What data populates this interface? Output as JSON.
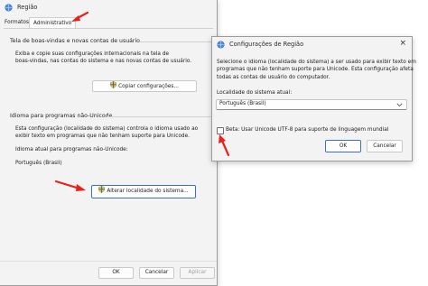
{
  "main_window": {
    "title": "Região",
    "tabs": [
      {
        "label": "Formatos"
      },
      {
        "label": "Administrativo"
      }
    ],
    "welcome_section": {
      "title": "Tela de boas-vindas e novas contas de usuário",
      "lines": [
        "Exiba e copie suas configurações internacionais na tela de",
        "boas-vindas, nas contas do sistema e nas novas contas de usuário."
      ],
      "copy_button": "Copiar configurações..."
    },
    "unicode_section": {
      "title": "Idioma para programas não-Unicode",
      "lines": [
        "Esta configuração (localidade do sistema) controla o idioma usado ao",
        "exibir texto em programas que não tenham suporte para Unicode."
      ],
      "current_label": "Idioma atual para programas não-Unicode:",
      "current_value": "Português (Brasil)",
      "change_button": "Alterar localidade do sistema..."
    },
    "footer": {
      "ok": "OK",
      "cancel": "Cancelar",
      "apply": "Aplicar"
    }
  },
  "dialog": {
    "title": "Configurações de Região",
    "lines": [
      "Selecione o idioma (localidade do sistema) a ser usado para exibir texto em",
      "programas que não tenham suporte para Unicode. Esta configuração afeta",
      "todas as contas de usuário do computador."
    ],
    "locale_label": "Localidade do sistema atual:",
    "locale_value": "Português (Brasil)",
    "beta_checkbox_label": "Beta: Usar Unicode UTF-8 para suporte de linguagem mundial",
    "beta_checked": false,
    "ok": "OK",
    "cancel": "Cancelar"
  },
  "icons": {
    "app": "globe-settings-icon",
    "close": "close-icon",
    "shield": "uac-shield-icon",
    "dropdown": "chevron-down-icon",
    "annotation": "red-arrow-icon"
  },
  "colors": {
    "annotation_arrow": "#e8211a",
    "primary_border": "#3a6fd0",
    "window_bg": "#f3f3f3"
  }
}
